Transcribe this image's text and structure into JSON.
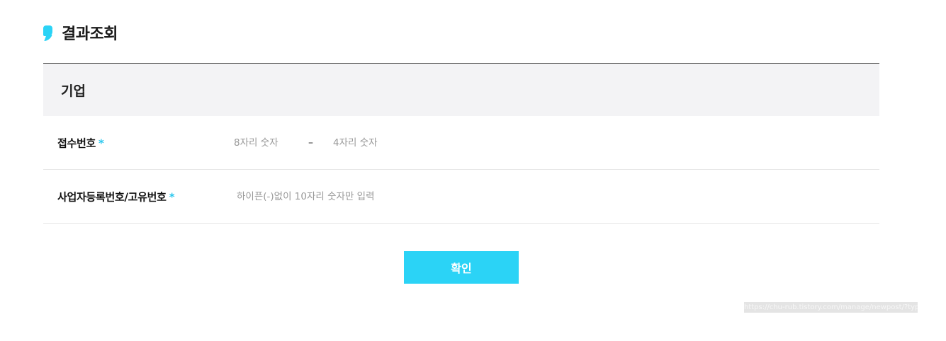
{
  "page": {
    "title": "결과조회"
  },
  "section": {
    "heading": "기업"
  },
  "form": {
    "receipt": {
      "label": "접수번호",
      "required_mark": "*",
      "part1_placeholder": "8자리 숫자",
      "separator": "–",
      "part2_placeholder": "4자리 숫자"
    },
    "business_number": {
      "label": "사업자등록번호/고유번호",
      "required_mark": "*",
      "placeholder": "하이픈(-)없이 10자리 숫자만 입력"
    }
  },
  "actions": {
    "confirm_label": "확인"
  },
  "overlay": {
    "url_tooltip": "https://chu-rub.tistory.com/manage/newpost/?type=p"
  },
  "colors": {
    "accent": "#2bd3f6",
    "header_bg": "#f3f3f5",
    "required": "#2bc7ee"
  },
  "icons": {
    "title_mark": "quote-mark-icon"
  }
}
